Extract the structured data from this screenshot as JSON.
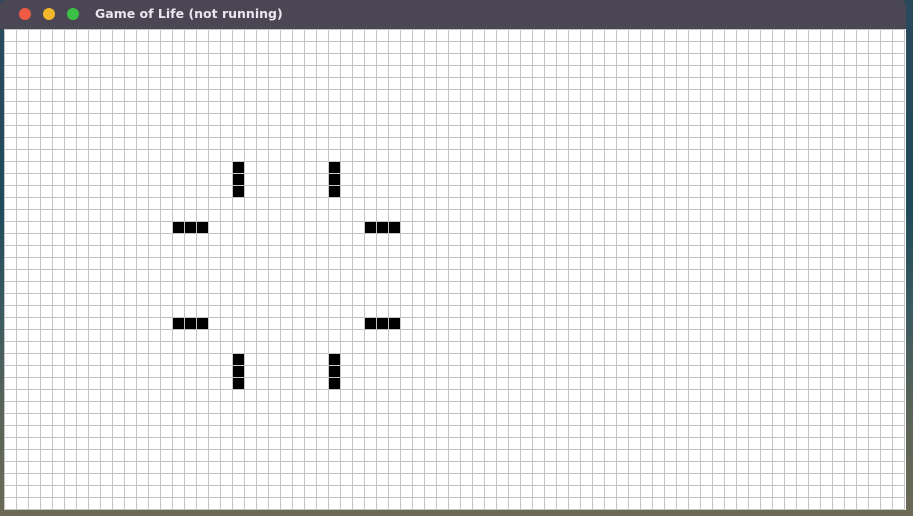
{
  "window": {
    "title": "Game of Life (not running)",
    "controls": [
      "close",
      "minimize",
      "maximize"
    ],
    "colors": {
      "titlebar": "#4b4654",
      "close": "#ee5a44",
      "minimize": "#f4b72c",
      "maximize": "#3cc043"
    }
  },
  "board": {
    "cols": 75,
    "rows": 40,
    "grid_color": "#c4c4c4",
    "alive_color": "#000000",
    "dead_color": "#ffffff",
    "alive_cells": [
      [
        19,
        11
      ],
      [
        19,
        12
      ],
      [
        19,
        13
      ],
      [
        27,
        11
      ],
      [
        27,
        12
      ],
      [
        27,
        13
      ],
      [
        14,
        16
      ],
      [
        15,
        16
      ],
      [
        16,
        16
      ],
      [
        30,
        16
      ],
      [
        31,
        16
      ],
      [
        32,
        16
      ],
      [
        14,
        24
      ],
      [
        15,
        24
      ],
      [
        16,
        24
      ],
      [
        30,
        24
      ],
      [
        31,
        24
      ],
      [
        32,
        24
      ],
      [
        19,
        27
      ],
      [
        19,
        28
      ],
      [
        19,
        29
      ],
      [
        27,
        27
      ],
      [
        27,
        28
      ],
      [
        27,
        29
      ]
    ]
  }
}
